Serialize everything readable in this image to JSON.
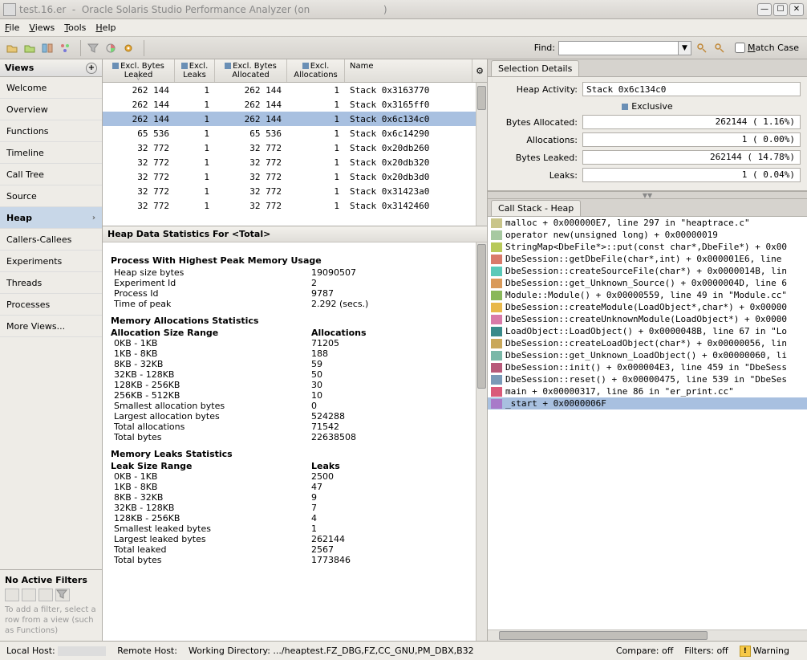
{
  "window": {
    "doc": "test.16.er",
    "app": "Oracle Solaris Studio Performance Analyzer",
    "on": "(on"
  },
  "menu": {
    "file": "File",
    "views": "Views",
    "tools": "Tools",
    "help": "Help"
  },
  "toolbar": {
    "find_label": "Find:",
    "match_case": "Match Case"
  },
  "sidebar": {
    "header": "Views",
    "items": [
      "Welcome",
      "Overview",
      "Functions",
      "Timeline",
      "Call Tree",
      "Source",
      "Heap",
      "Callers-Callees",
      "Experiments",
      "Threads",
      "Processes",
      "More Views..."
    ],
    "selected": 6,
    "filters_hdr": "No Active Filters",
    "filters_hint": "To add a filter, select a row from a view (such as Functions)"
  },
  "table": {
    "cols": [
      "Excl. Bytes Leaked",
      "Excl. Leaks",
      "Excl. Bytes Allocated",
      "Excl. Allocations",
      "Name"
    ],
    "rows": [
      {
        "c": [
          "262 144",
          "1",
          "262 144",
          "1",
          "Stack 0x3163770"
        ]
      },
      {
        "c": [
          "262 144",
          "1",
          "262 144",
          "1",
          "Stack 0x3165ff0"
        ]
      },
      {
        "c": [
          "262 144",
          "1",
          "262 144",
          "1",
          "Stack 0x6c134c0"
        ],
        "sel": true
      },
      {
        "c": [
          "65 536",
          "1",
          "65 536",
          "1",
          "Stack 0x6c14290"
        ]
      },
      {
        "c": [
          "32 772",
          "1",
          "32 772",
          "1",
          "Stack 0x20db260"
        ]
      },
      {
        "c": [
          "32 772",
          "1",
          "32 772",
          "1",
          "Stack 0x20db320"
        ]
      },
      {
        "c": [
          "32 772",
          "1",
          "32 772",
          "1",
          "Stack 0x20db3d0"
        ]
      },
      {
        "c": [
          "32 772",
          "1",
          "32 772",
          "1",
          "Stack 0x31423a0"
        ]
      },
      {
        "c": [
          "32 772",
          "1",
          "32 772",
          "1",
          "Stack 0x3142460"
        ]
      }
    ]
  },
  "stats": {
    "header": "Heap Data Statistics For <Total>",
    "proc_hdr": "Process With Highest Peak Memory Usage",
    "proc": [
      [
        "Heap size bytes",
        "19090507"
      ],
      [
        "Experiment Id",
        "2"
      ],
      [
        "Process Id",
        "9787"
      ],
      [
        "Time of peak",
        "2.292 (secs.)"
      ]
    ],
    "alloc_hdr": "Memory Allocations Statistics",
    "alloc_cols": [
      "Allocation Size Range",
      "Allocations"
    ],
    "alloc": [
      [
        "0KB - 1KB",
        "71205"
      ],
      [
        "1KB - 8KB",
        "188"
      ],
      [
        "8KB - 32KB",
        "59"
      ],
      [
        "32KB - 128KB",
        "50"
      ],
      [
        "128KB - 256KB",
        "30"
      ],
      [
        "256KB - 512KB",
        "10"
      ],
      [
        "Smallest allocation bytes",
        "0"
      ],
      [
        "Largest allocation bytes",
        "524288"
      ],
      [
        "Total allocations",
        "71542"
      ],
      [
        "Total bytes",
        "22638508"
      ]
    ],
    "leak_hdr": "Memory Leaks Statistics",
    "leak_cols": [
      "Leak Size Range",
      "Leaks"
    ],
    "leak": [
      [
        "0KB - 1KB",
        "2500"
      ],
      [
        "1KB - 8KB",
        "47"
      ],
      [
        "8KB - 32KB",
        "9"
      ],
      [
        "32KB - 128KB",
        "7"
      ],
      [
        "128KB - 256KB",
        "4"
      ],
      [
        "Smallest leaked bytes",
        "1"
      ],
      [
        "Largest leaked bytes",
        "262144"
      ],
      [
        "Total leaked",
        "2567"
      ],
      [
        "Total bytes",
        "1773846"
      ]
    ]
  },
  "details": {
    "tab": "Selection Details",
    "heap_activity_lbl": "Heap Activity:",
    "heap_activity_val": "Stack 0x6c134c0",
    "excl_lbl": "Exclusive",
    "rows": [
      {
        "lbl": "Bytes Allocated:",
        "val": "262144 (  1.16%)"
      },
      {
        "lbl": "Allocations:",
        "val": "1 (  0.00%)"
      },
      {
        "lbl": "Bytes Leaked:",
        "val": "262144 ( 14.78%)"
      },
      {
        "lbl": "Leaks:",
        "val": "1 (  0.04%)"
      }
    ]
  },
  "callstack": {
    "tab": "Call Stack - Heap",
    "rows": [
      {
        "color": "#c9c58a",
        "t": "malloc + 0x000000E7, line 297 in \"heaptrace.c\""
      },
      {
        "color": "#a7c9a1",
        "t": "operator new(unsigned long) + 0x00000019"
      },
      {
        "color": "#b8c95a",
        "t": "StringMap<DbeFile*>::put(const char*,DbeFile*) + 0x00"
      },
      {
        "color": "#d97a6a",
        "t": "DbeSession::getDbeFile(char*,int) + 0x000001E6, line"
      },
      {
        "color": "#5ac9b8",
        "t": "DbeSession::createSourceFile(char*) + 0x0000014B, lin"
      },
      {
        "color": "#d99a5a",
        "t": "DbeSession::get_Unknown_Source() + 0x0000004D, line 6"
      },
      {
        "color": "#8ab85a",
        "t": "Module::Module() + 0x00000559, line 49 in \"Module.cc\""
      },
      {
        "color": "#e8b84a",
        "t": "DbeSession::createModule(LoadObject*,char*) + 0x00000"
      },
      {
        "color": "#d97aa8",
        "t": "DbeSession::createUnknownModule(LoadObject*) + 0x0000"
      },
      {
        "color": "#3a8a8a",
        "t": "LoadObject::LoadObject() + 0x0000048B, line 67 in \"Lo"
      },
      {
        "color": "#c9a85a",
        "t": "DbeSession::createLoadObject(char*) + 0x00000056, lin"
      },
      {
        "color": "#7ab8a8",
        "t": "DbeSession::get_Unknown_LoadObject() + 0x00000060, li"
      },
      {
        "color": "#b85a7a",
        "t": "DbeSession::init() + 0x000004E3, line 459 in \"DbeSess"
      },
      {
        "color": "#7a9ab8",
        "t": "DbeSession::reset() + 0x00000475, line 539 in \"DbeSes"
      },
      {
        "color": "#d95a7a",
        "t": "main + 0x00000317, line 86 in \"er_print.cc\""
      },
      {
        "color": "#a87ac9",
        "t": "_start + 0x0000006F",
        "sel": true
      }
    ]
  },
  "statusbar": {
    "local": "Local Host:",
    "remote": "Remote Host:",
    "wd": "Working Directory: .../heaptest.FZ_DBG,FZ,CC_GNU,PM_DBX,B32",
    "compare": "Compare: off",
    "filters": "Filters: off",
    "warning": "Warning"
  }
}
